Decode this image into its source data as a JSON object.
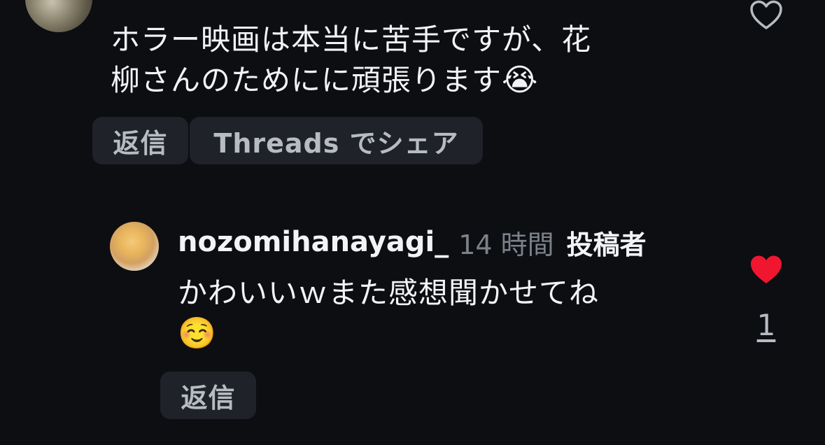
{
  "comment": {
    "line1": "ホラー映画は本当に苦手ですが、花",
    "line2_text": "柳さんのためにに頑張ります",
    "line2_emoji": "😭",
    "reply_label": "返信",
    "share_label": "Threads でシェア"
  },
  "reply": {
    "username": "nozomihanayagi_",
    "time": "14 時間",
    "author_badge": "投稿者",
    "line1": "かわいいｗまた感想聞かせてね",
    "emoji": "☺️",
    "reply_label": "返信",
    "like_count": "1"
  },
  "colors": {
    "background": "#0c0e12",
    "chip": "#1f2228",
    "liked_heart": "#f0162f",
    "muted_text": "#7c8189"
  },
  "icons": {
    "top_like": "heart-outline-icon",
    "reply_like": "heart-filled-icon"
  }
}
